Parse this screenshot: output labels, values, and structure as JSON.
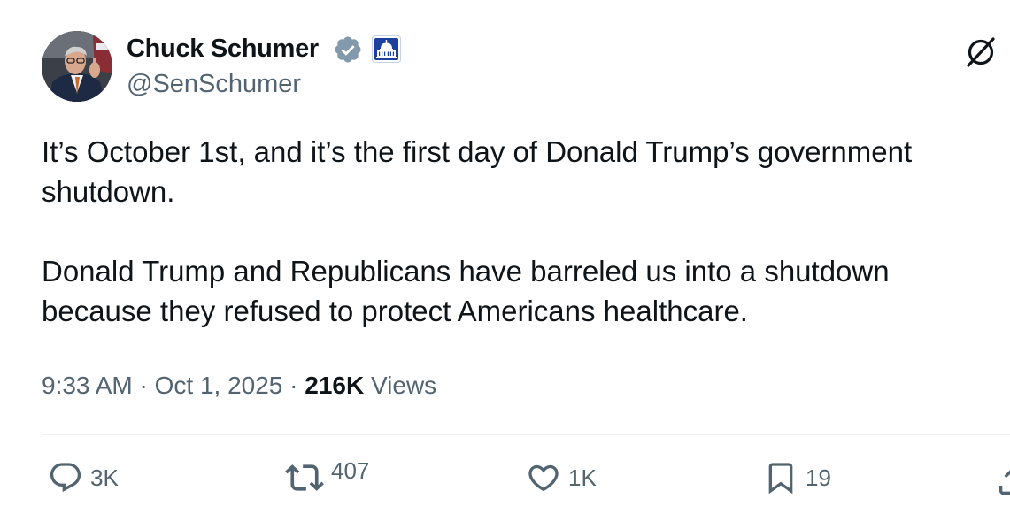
{
  "post": {
    "author": {
      "name": "Chuck Schumer",
      "handle": "@SenSchumer",
      "verified": true,
      "affiliate_badge": "capitol-building-icon"
    },
    "text": {
      "paragraph1": "It’s October 1st, and it’s the first day of Donald Trump’s government shutdown.",
      "paragraph2": "Donald Trump and Republicans have barreled us into a shutdown because they refused to protect Americans healthcare."
    },
    "meta": {
      "time": "9:33 AM",
      "separator": "·",
      "date": "Oct 1, 2025",
      "views_count": "216K",
      "views_label": "Views"
    },
    "actions": {
      "replies": "3K",
      "reposts": "407",
      "likes": "1K",
      "bookmarks": "19"
    }
  },
  "icons": {
    "verified": "verified-badge-icon",
    "grok": "grok-icon",
    "reply": "reply-icon",
    "repost": "repost-icon",
    "like": "heart-icon",
    "bookmark": "bookmark-icon",
    "share": "share-icon"
  },
  "colors": {
    "text_primary": "#0f1419",
    "text_secondary": "#536471",
    "verified_badge": "#829aab",
    "affiliate_badge": "#1d3f9e",
    "divider": "#eff3f4"
  }
}
